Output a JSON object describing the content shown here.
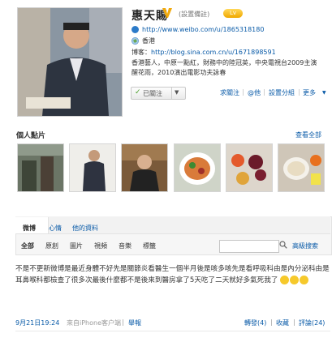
{
  "profile": {
    "name": "惠天賜",
    "remark": "(設置備註)",
    "level_badge": "Lv",
    "weibo_url": "http://www.weibo.com/u/1865318180",
    "location": "香港",
    "blog_prefix": "博客：",
    "blog_url": "http://blog.sina.com.cn/u/1671898591",
    "bio": "香港藝人，中原一點紅，財務中的陸冠英，中央電視台2009主演醒花雨，2010演出電影功夫詠春",
    "followed_label": "已關注",
    "actions": {
      "ask_follow": "求關注",
      "mention": "@他",
      "set_group": "設置分組",
      "more": "更多"
    }
  },
  "photos": {
    "title": "個人點片",
    "view_all": "查看全部"
  },
  "feed": {
    "tabs": [
      "微博",
      "心情",
      "他的資料"
    ],
    "filters": [
      "全部",
      "原創",
      "圖片",
      "視頻",
      "音樂",
      "標籤"
    ],
    "search_placeholder": "",
    "advanced_search": "高級搜索"
  },
  "post": {
    "text": "不是不更新微博是最近身體不好先是關節炎看醫生一個半月後是咳多咳先是看呼吸科由是內分泌科由是耳鼻喉科都檢查了很多次最後什麼都不是後來到醫房拿了5天吃了二天就好多氣死我了",
    "timestamp": "9月21日19:24",
    "source": "來自iPhone客户端",
    "report": "舉報",
    "repost": "轉發(4)",
    "favorite": "收藏",
    "comment": "評論(24)"
  },
  "colors": {
    "link": "#0a5ba8",
    "verified": "#f1a90c"
  }
}
